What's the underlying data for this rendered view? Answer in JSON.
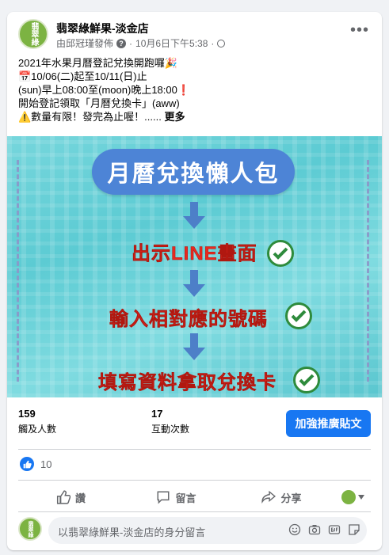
{
  "post": {
    "page_name": "翡翠綠鮮果-淡金店",
    "avatar_text": "翡翠綠",
    "published_by": "由邱冠瑾發佈",
    "date": "10月6日下午5:38",
    "text_lines": [
      "2021年水果月曆登記兌換開跑囉🎉",
      "📅10/06(二)起至10/11(日)止",
      "(sun)早上08:00至(moon)晚上18:00❗",
      "開始登記領取「月曆兌換卡」(aww)",
      "⚠️數量有限！發完為止喔！......"
    ],
    "see_more": "更多"
  },
  "promo": {
    "title": "月曆兌換懶人包",
    "steps": [
      "出示LINE畫面",
      "輸入相對應的號碼",
      "填寫資料拿取兌換卡"
    ]
  },
  "stats": {
    "reach_value": "159",
    "reach_label": "觸及人數",
    "engagement_value": "17",
    "engagement_label": "互動次數",
    "boost_label": "加強推廣貼文"
  },
  "reactions": {
    "count": "10"
  },
  "actions": {
    "like": "讚",
    "comment": "留言",
    "share": "分享"
  },
  "composer": {
    "placeholder": "以翡翠綠鮮果-淡金店的身分留言"
  },
  "colors": {
    "accent": "#1877f2",
    "promo_title_bg": "#4d84d6",
    "step_text": "#e8291f",
    "check": "#2e8b3c"
  }
}
